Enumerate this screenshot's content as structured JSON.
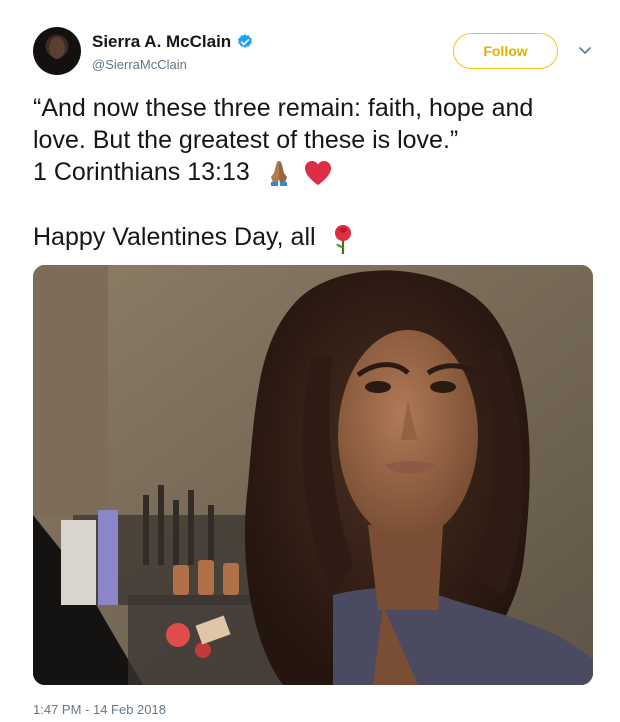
{
  "user": {
    "display_name": "Sierra A. McClain",
    "handle": "@SierraMcClain",
    "verified": true
  },
  "follow_button": {
    "label": "Follow"
  },
  "tweet": {
    "lines": [
      "“And now these three remain: faith, hope and",
      "love. But the greatest of these is love.”",
      "1 Corinthians 13:13"
    ],
    "greeting": "Happy Valentines Day, all",
    "emojis": [
      "folded-hands-icon",
      "red-heart-icon",
      "rose-icon"
    ],
    "timestamp": "1:47 PM - 14 Feb 2018"
  },
  "colors": {
    "follow_accent": "#e2b100",
    "verified_blue": "#1da1f2",
    "secondary_text": "#657786",
    "heart_red": "#dd2e44"
  }
}
